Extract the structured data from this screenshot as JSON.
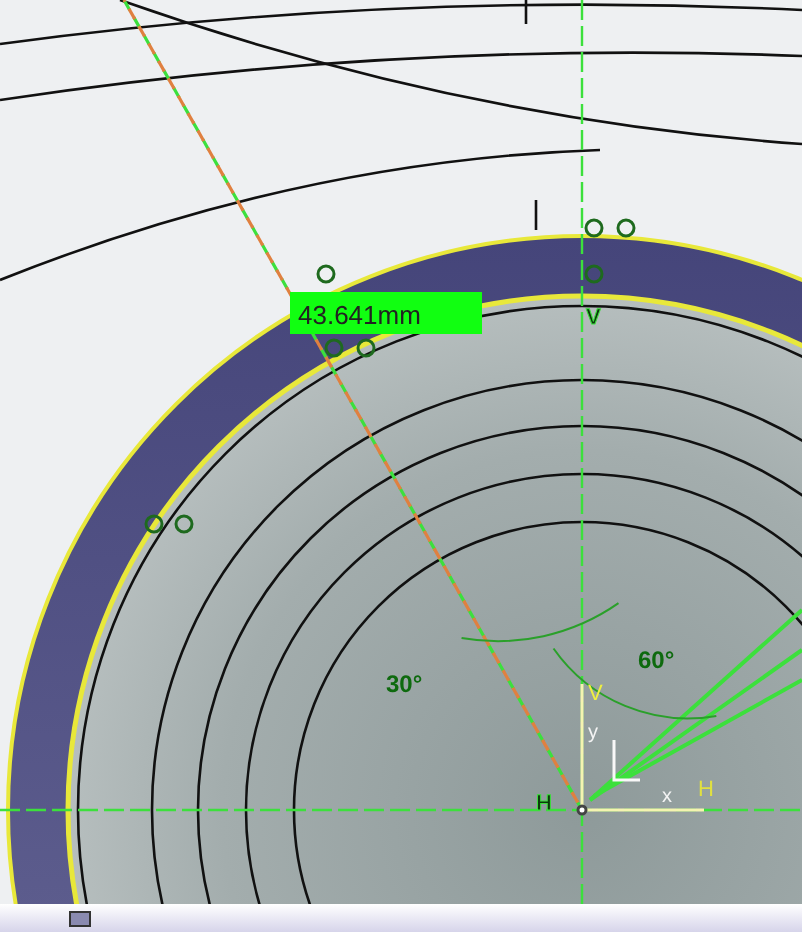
{
  "dimension": {
    "value": "43.641mm"
  },
  "angles": [
    "30°",
    "60°"
  ],
  "constraint_marks": [
    "V",
    "H"
  ],
  "axis": {
    "v_label": "V",
    "h_label": "H",
    "y_label": "y",
    "x_label": "x"
  }
}
